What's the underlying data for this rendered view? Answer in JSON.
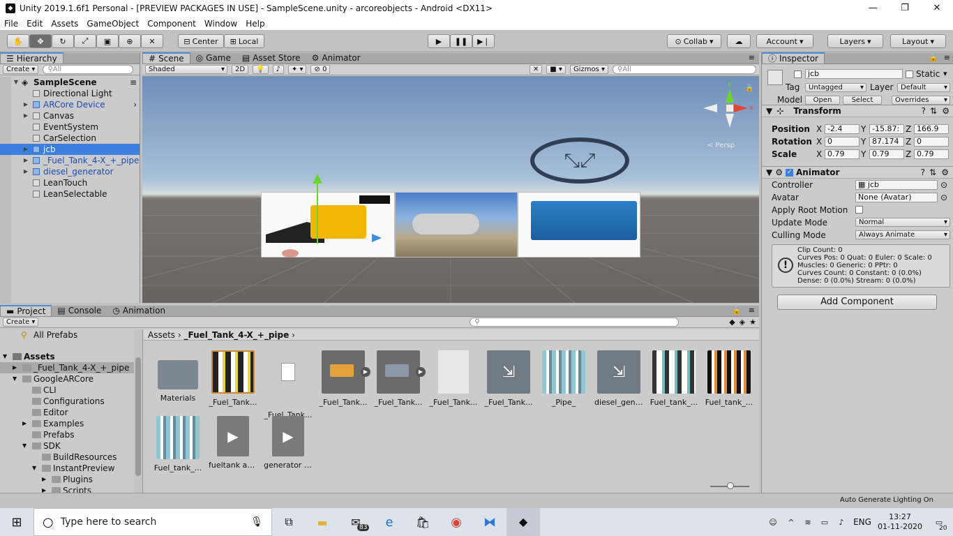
{
  "window": {
    "title": "Unity 2019.1.6f1 Personal - [PREVIEW PACKAGES IN USE] - SampleScene.unity - arcoreobjects - Android <DX11>",
    "minimize": "—",
    "maximize": "❐",
    "close": "✕"
  },
  "menu": [
    "File",
    "Edit",
    "Assets",
    "GameObject",
    "Component",
    "Window",
    "Help"
  ],
  "toolbar": {
    "pivot": "Center",
    "space": "Local",
    "collab": "Collab",
    "account": "Account",
    "layers": "Layers",
    "layout": "Layout"
  },
  "hierarchy": {
    "tab": "Hierarchy",
    "create": "Create",
    "search_placeholder": "All",
    "scene": "SampleScene",
    "items": [
      {
        "label": "Directional Light",
        "prefab": false,
        "expand": false,
        "selected": false
      },
      {
        "label": "ARCore Device",
        "prefab": true,
        "expand": true,
        "selected": false
      },
      {
        "label": "Canvas",
        "prefab": false,
        "expand": true,
        "selected": false
      },
      {
        "label": "EventSystem",
        "prefab": false,
        "expand": false,
        "selected": false
      },
      {
        "label": "CarSelection",
        "prefab": false,
        "expand": false,
        "selected": false
      },
      {
        "label": "jcb",
        "prefab": true,
        "expand": true,
        "selected": true
      },
      {
        "label": "_Fuel_Tank_4-X_+_pipe",
        "prefab": true,
        "expand": true,
        "selected": false
      },
      {
        "label": "diesel_generator",
        "prefab": true,
        "expand": true,
        "selected": false
      },
      {
        "label": "LeanTouch",
        "prefab": false,
        "expand": false,
        "selected": false
      },
      {
        "label": "LeanSelectable",
        "prefab": false,
        "expand": false,
        "selected": false
      }
    ]
  },
  "scene": {
    "tabs": [
      "Scene",
      "Game",
      "Asset Store",
      "Animator"
    ],
    "shading": "Shaded",
    "mode2d": "2D",
    "hidden_count": "0",
    "gizmos": "Gizmos",
    "search_placeholder": "All",
    "persp": "< Persp",
    "gizmo_y": "y",
    "gizmo_x": "x"
  },
  "inspector": {
    "tab": "Inspector",
    "name": "jcb",
    "static": "Static",
    "tag_label": "Tag",
    "tag": "Untagged",
    "layer_label": "Layer",
    "layer": "Default",
    "model_label": "Model",
    "open": "Open",
    "select": "Select",
    "overrides": "Overrides",
    "transform": {
      "title": "Transform",
      "position_label": "Position",
      "rotation_label": "Rotation",
      "scale_label": "Scale",
      "axes": [
        "X",
        "Y",
        "Z"
      ],
      "position": [
        "-2.4",
        "-15.87:",
        "166.9"
      ],
      "rotation": [
        "0",
        "87.174",
        "0"
      ],
      "scale": [
        "0.79",
        "0.79",
        "0.79"
      ]
    },
    "animator": {
      "title": "Animator",
      "controller_label": "Controller",
      "controller": "jcb",
      "avatar_label": "Avatar",
      "avatar": "None (Avatar)",
      "apply_root_label": "Apply Root Motion",
      "update_label": "Update Mode",
      "update": "Normal",
      "culling_label": "Culling Mode",
      "culling": "Always Animate",
      "info": [
        "Clip Count: 0",
        "Curves Pos: 0 Quat: 0 Euler: 0 Scale: 0",
        "Muscles: 0 Generic: 0 PPtr: 0",
        "Curves Count: 0 Constant: 0 (0.0%)",
        "Dense: 0 (0.0%) Stream: 0 (0.0%)"
      ]
    },
    "add_component": "Add Component"
  },
  "project": {
    "tabs": [
      "Project",
      "Console",
      "Animation"
    ],
    "create": "Create",
    "all_prefabs": "All Prefabs",
    "breadcrumb": [
      "Assets",
      "_Fuel_Tank_4-X_+_pipe"
    ],
    "tree": [
      {
        "label": "Assets",
        "indent": 0,
        "bold": true,
        "sel": false
      },
      {
        "label": "_Fuel_Tank_4-X_+_pipe",
        "indent": 1,
        "bold": false,
        "sel": true
      },
      {
        "label": "GoogleARCore",
        "indent": 1,
        "bold": false,
        "sel": false
      },
      {
        "label": "CLI",
        "indent": 2,
        "bold": false,
        "sel": false
      },
      {
        "label": "Configurations",
        "indent": 2,
        "bold": false,
        "sel": false
      },
      {
        "label": "Editor",
        "indent": 2,
        "bold": false,
        "sel": false
      },
      {
        "label": "Examples",
        "indent": 2,
        "bold": false,
        "sel": false
      },
      {
        "label": "Prefabs",
        "indent": 2,
        "bold": false,
        "sel": false
      },
      {
        "label": "SDK",
        "indent": 2,
        "bold": false,
        "sel": false
      },
      {
        "label": "BuildResources",
        "indent": 3,
        "bold": false,
        "sel": false
      },
      {
        "label": "InstantPreview",
        "indent": 3,
        "bold": false,
        "sel": false
      },
      {
        "label": "Plugins",
        "indent": 4,
        "bold": false,
        "sel": false
      },
      {
        "label": "Scripts",
        "indent": 4,
        "bold": false,
        "sel": false
      }
    ],
    "assets": [
      {
        "label": "Materials",
        "kind": "folder"
      },
      {
        "label": "_Fuel_Tank...",
        "kind": "texture"
      },
      {
        "label": "_Fuel_Tank...",
        "kind": "file"
      },
      {
        "label": "_Fuel_Tank...",
        "kind": "model"
      },
      {
        "label": "_Fuel_Tank...",
        "kind": "model2"
      },
      {
        "label": "_Fuel_Tank...",
        "kind": "doc"
      },
      {
        "label": "_Fuel_Tank...",
        "kind": "anim"
      },
      {
        "label": "_Pipe_",
        "kind": "texture2"
      },
      {
        "label": "diesel_gene...",
        "kind": "anim"
      },
      {
        "label": "Fuel_tank_...",
        "kind": "texture3"
      },
      {
        "label": "Fuel_tank_...",
        "kind": "texture4"
      },
      {
        "label": "Fuel_tank_...",
        "kind": "texture2"
      },
      {
        "label": "fueltank an...",
        "kind": "clip"
      },
      {
        "label": "generator a...",
        "kind": "clip"
      }
    ]
  },
  "status": {
    "text": "Auto Generate Lighting On"
  },
  "taskbar": {
    "search": "Type here to search",
    "mail_badge": "83",
    "lang": "ENG",
    "time": "13:27",
    "date": "01-11-2020",
    "notif": "20"
  }
}
